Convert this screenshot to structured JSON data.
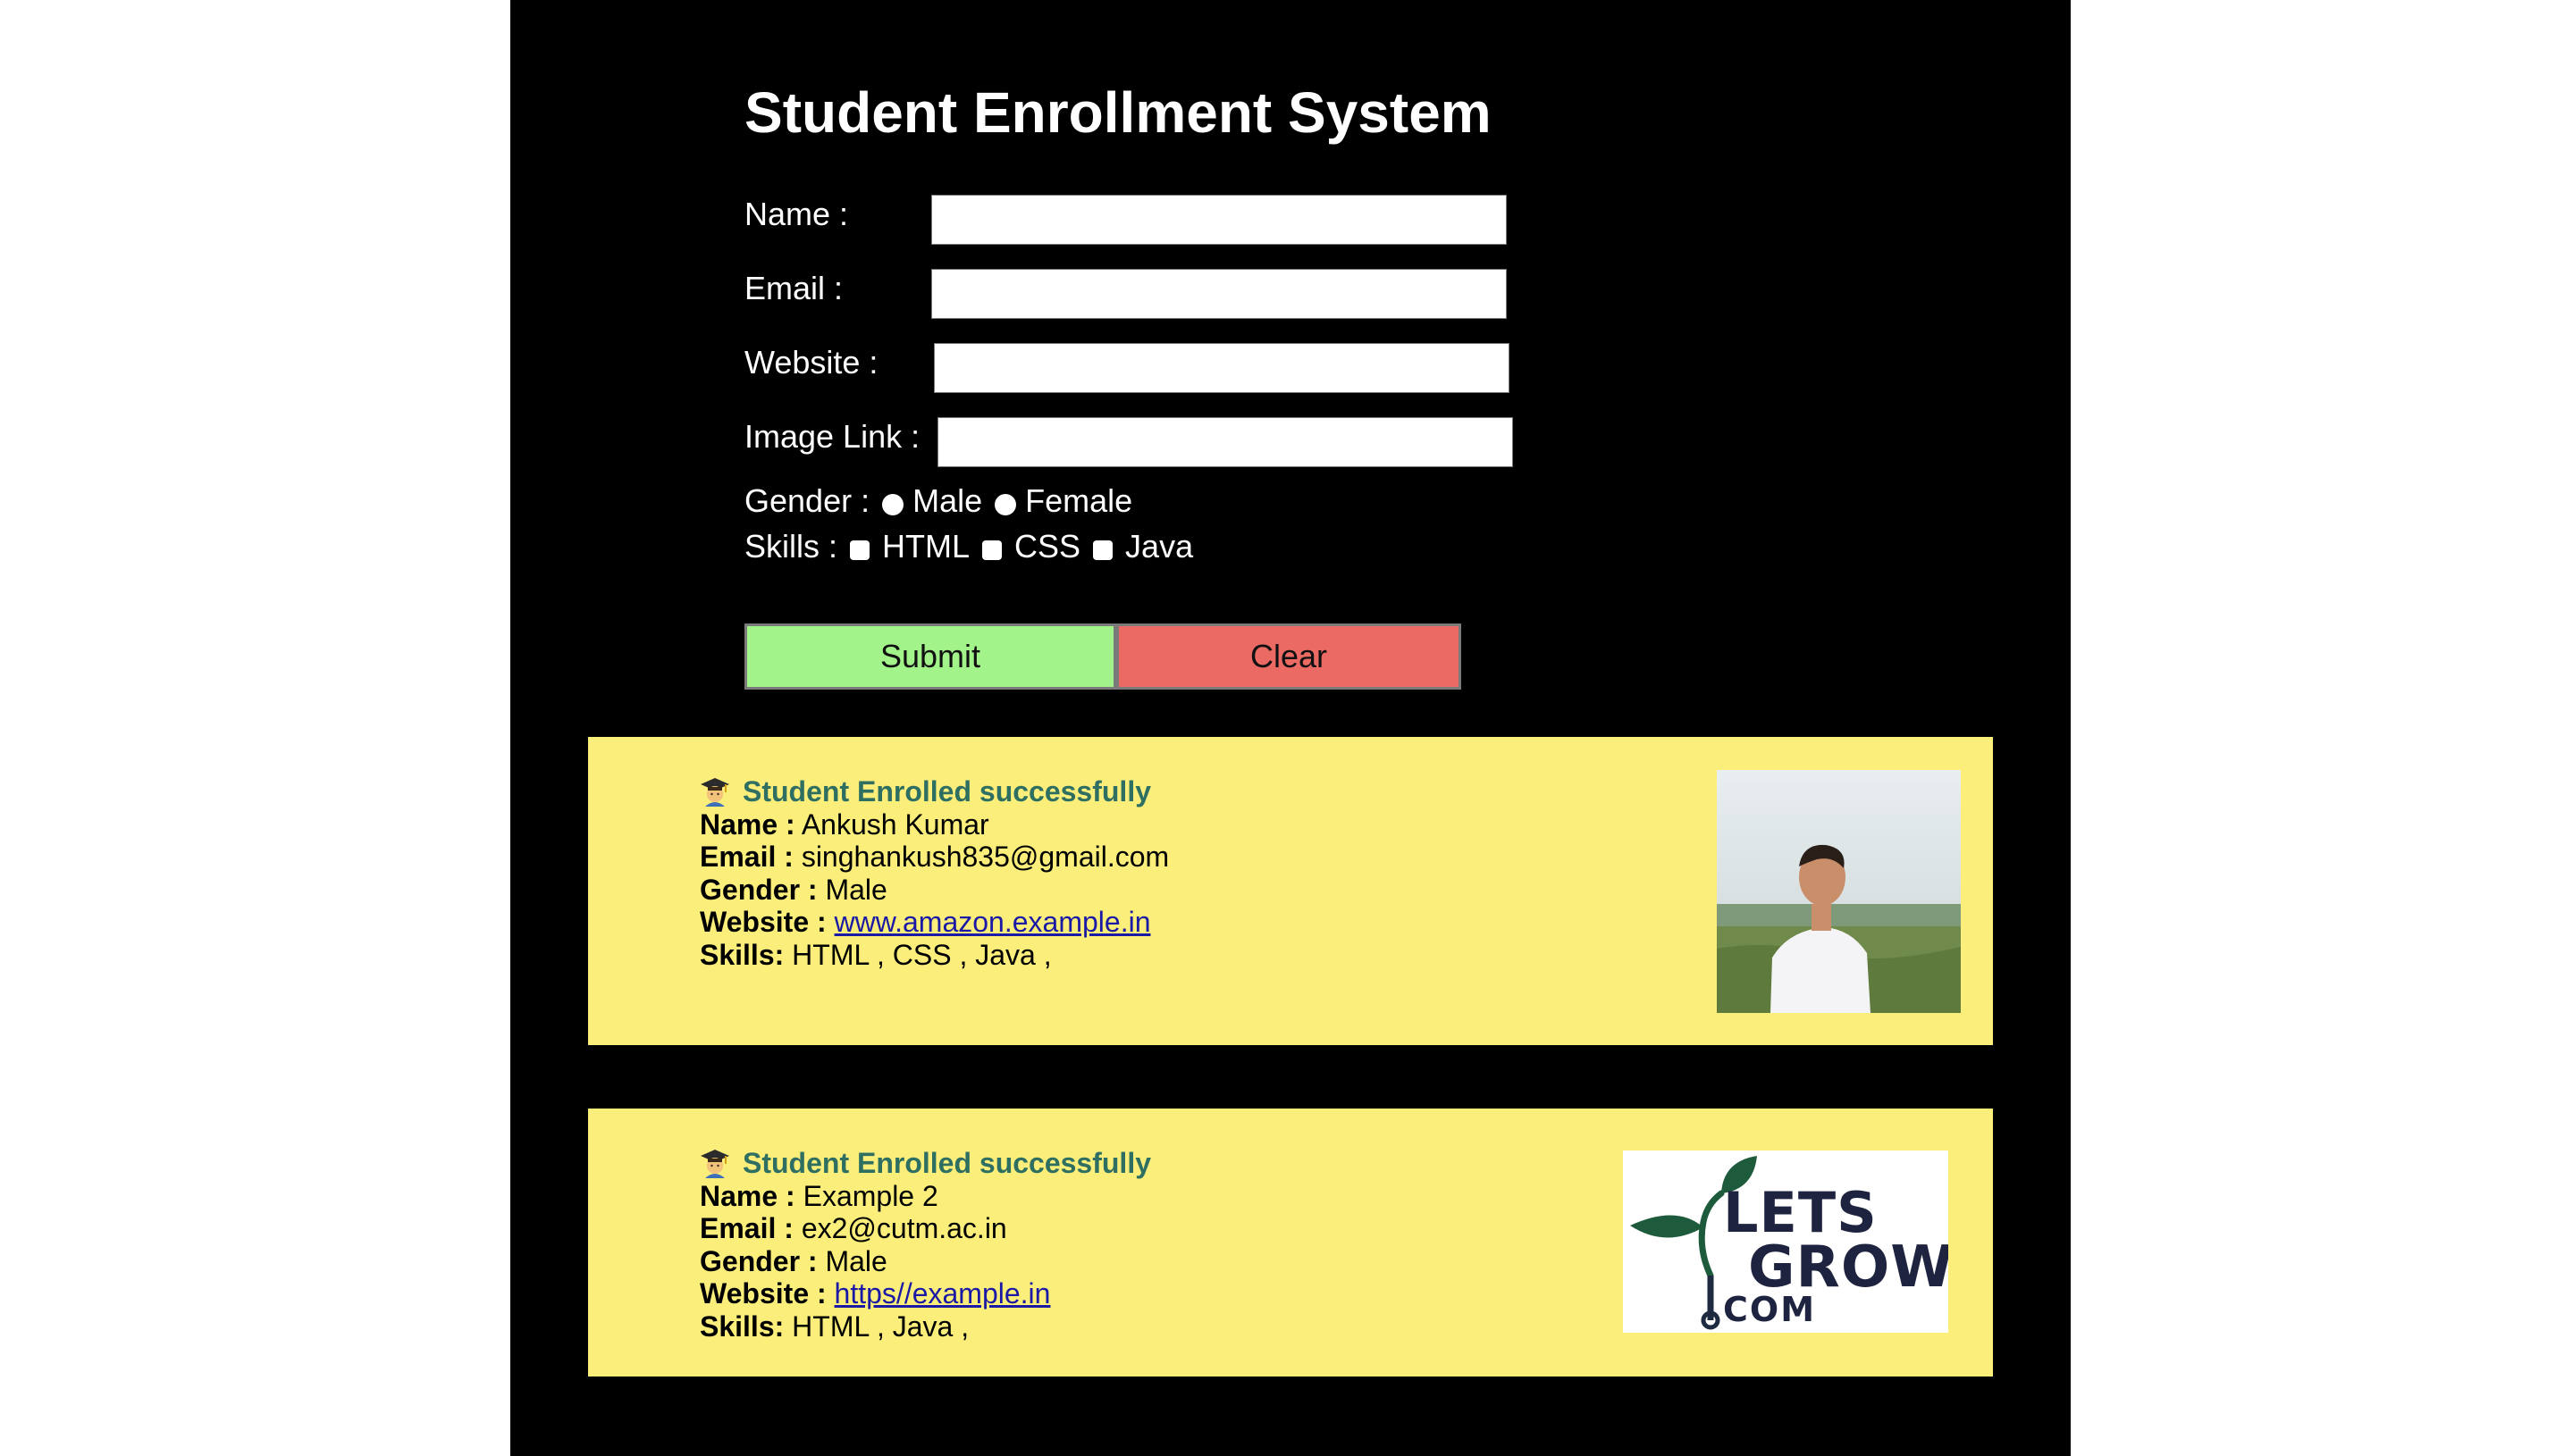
{
  "form": {
    "title": "Student Enrollment System",
    "name_label": "Name :",
    "email_label": "Email :",
    "website_label": "Website :",
    "image_label": "Image Link :",
    "name_value": "",
    "email_value": "",
    "website_value": "",
    "image_value": "",
    "gender_label": "Gender :",
    "gender_options": [
      "Male",
      "Female"
    ],
    "skills_label": "Skills :",
    "skill_options": [
      "HTML",
      "CSS",
      "Java"
    ],
    "submit_label": "Submit",
    "clear_label": "Clear"
  },
  "colors": {
    "page_bg": "#000000",
    "card_bg": "#fbee7a",
    "success_text": "#2e6f62",
    "submit_bg": "#a2f38a",
    "clear_bg": "#eb6a63",
    "link": "#1a1aa6"
  },
  "students": [
    {
      "heading": "Student Enrolled successfully",
      "name_key": "Name :",
      "name": "Ankush Kumar",
      "email_key": "Email :",
      "email": "singhankush835@gmail.com",
      "gender_key": "Gender :",
      "gender": "Male",
      "website_key": "Website :",
      "website": "www.amazon.example.in",
      "skills_key": "Skills:",
      "skills": "HTML , CSS , Java ,",
      "image_icon": "person-photo"
    },
    {
      "heading": "Student Enrolled successfully",
      "name_key": "Name :",
      "name": "Example 2",
      "email_key": "Email :",
      "email": "ex2@cutm.ac.in",
      "gender_key": "Gender :",
      "gender": "Male",
      "website_key": "Website :",
      "website": "https//example.in",
      "skills_key": "Skills:",
      "skills": "HTML , Java ,",
      "image_logo_line1": "LETS",
      "image_logo_line2": "GROW",
      "image_logo_line3": "COM"
    }
  ]
}
